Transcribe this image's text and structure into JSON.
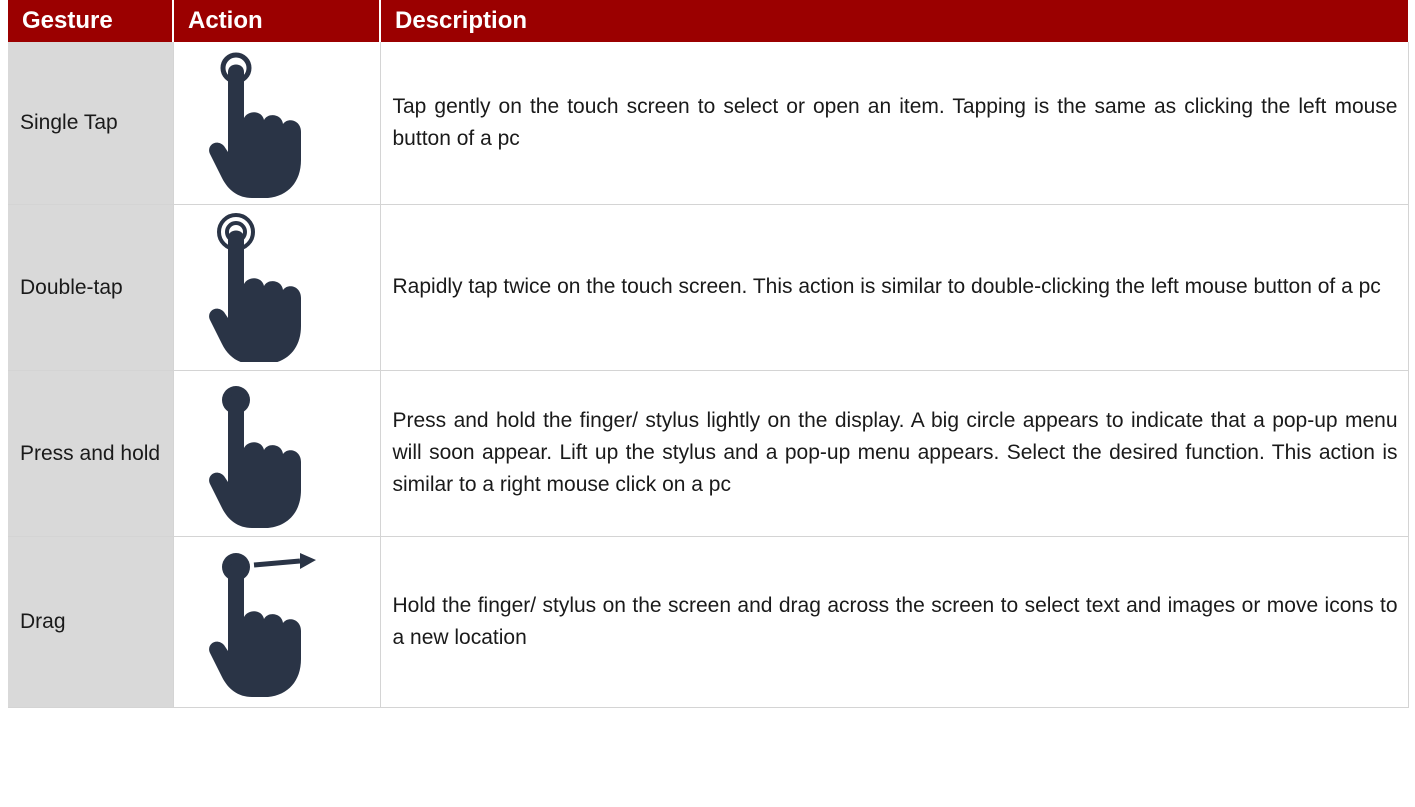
{
  "table": {
    "headers": [
      "Gesture",
      "Action",
      "Description"
    ],
    "rows": [
      {
        "gesture": "Single Tap",
        "icon": "single-tap-hand-icon",
        "description": "Tap gently on the touch screen to select or open an item. Tapping is the same as clicking the left mouse button of a pc"
      },
      {
        "gesture": "Double-tap",
        "icon": "double-tap-hand-icon",
        "description": "Rapidly tap twice on the touch screen. This action is similar to double-clicking the left mouse button of a pc"
      },
      {
        "gesture": "Press and hold",
        "icon": "press-hold-hand-icon",
        "description": "Press and hold the finger/ stylus lightly on the display. A big circle appears to indicate that a pop-up menu will soon appear. Lift up the stylus and a pop-up menu appears. Select the desired function. This action is similar to a right mouse click on a pc"
      },
      {
        "gesture": "Drag",
        "icon": "drag-hand-icon",
        "description": "Hold the finger/ stylus on the screen and drag across the screen to select text and images or move icons to a new location"
      }
    ]
  },
  "colors": {
    "header_background": "#9b0000",
    "header_text": "#ffffff",
    "gesture_column_background": "#d9d9d9",
    "icon_fill": "#2a3446"
  }
}
